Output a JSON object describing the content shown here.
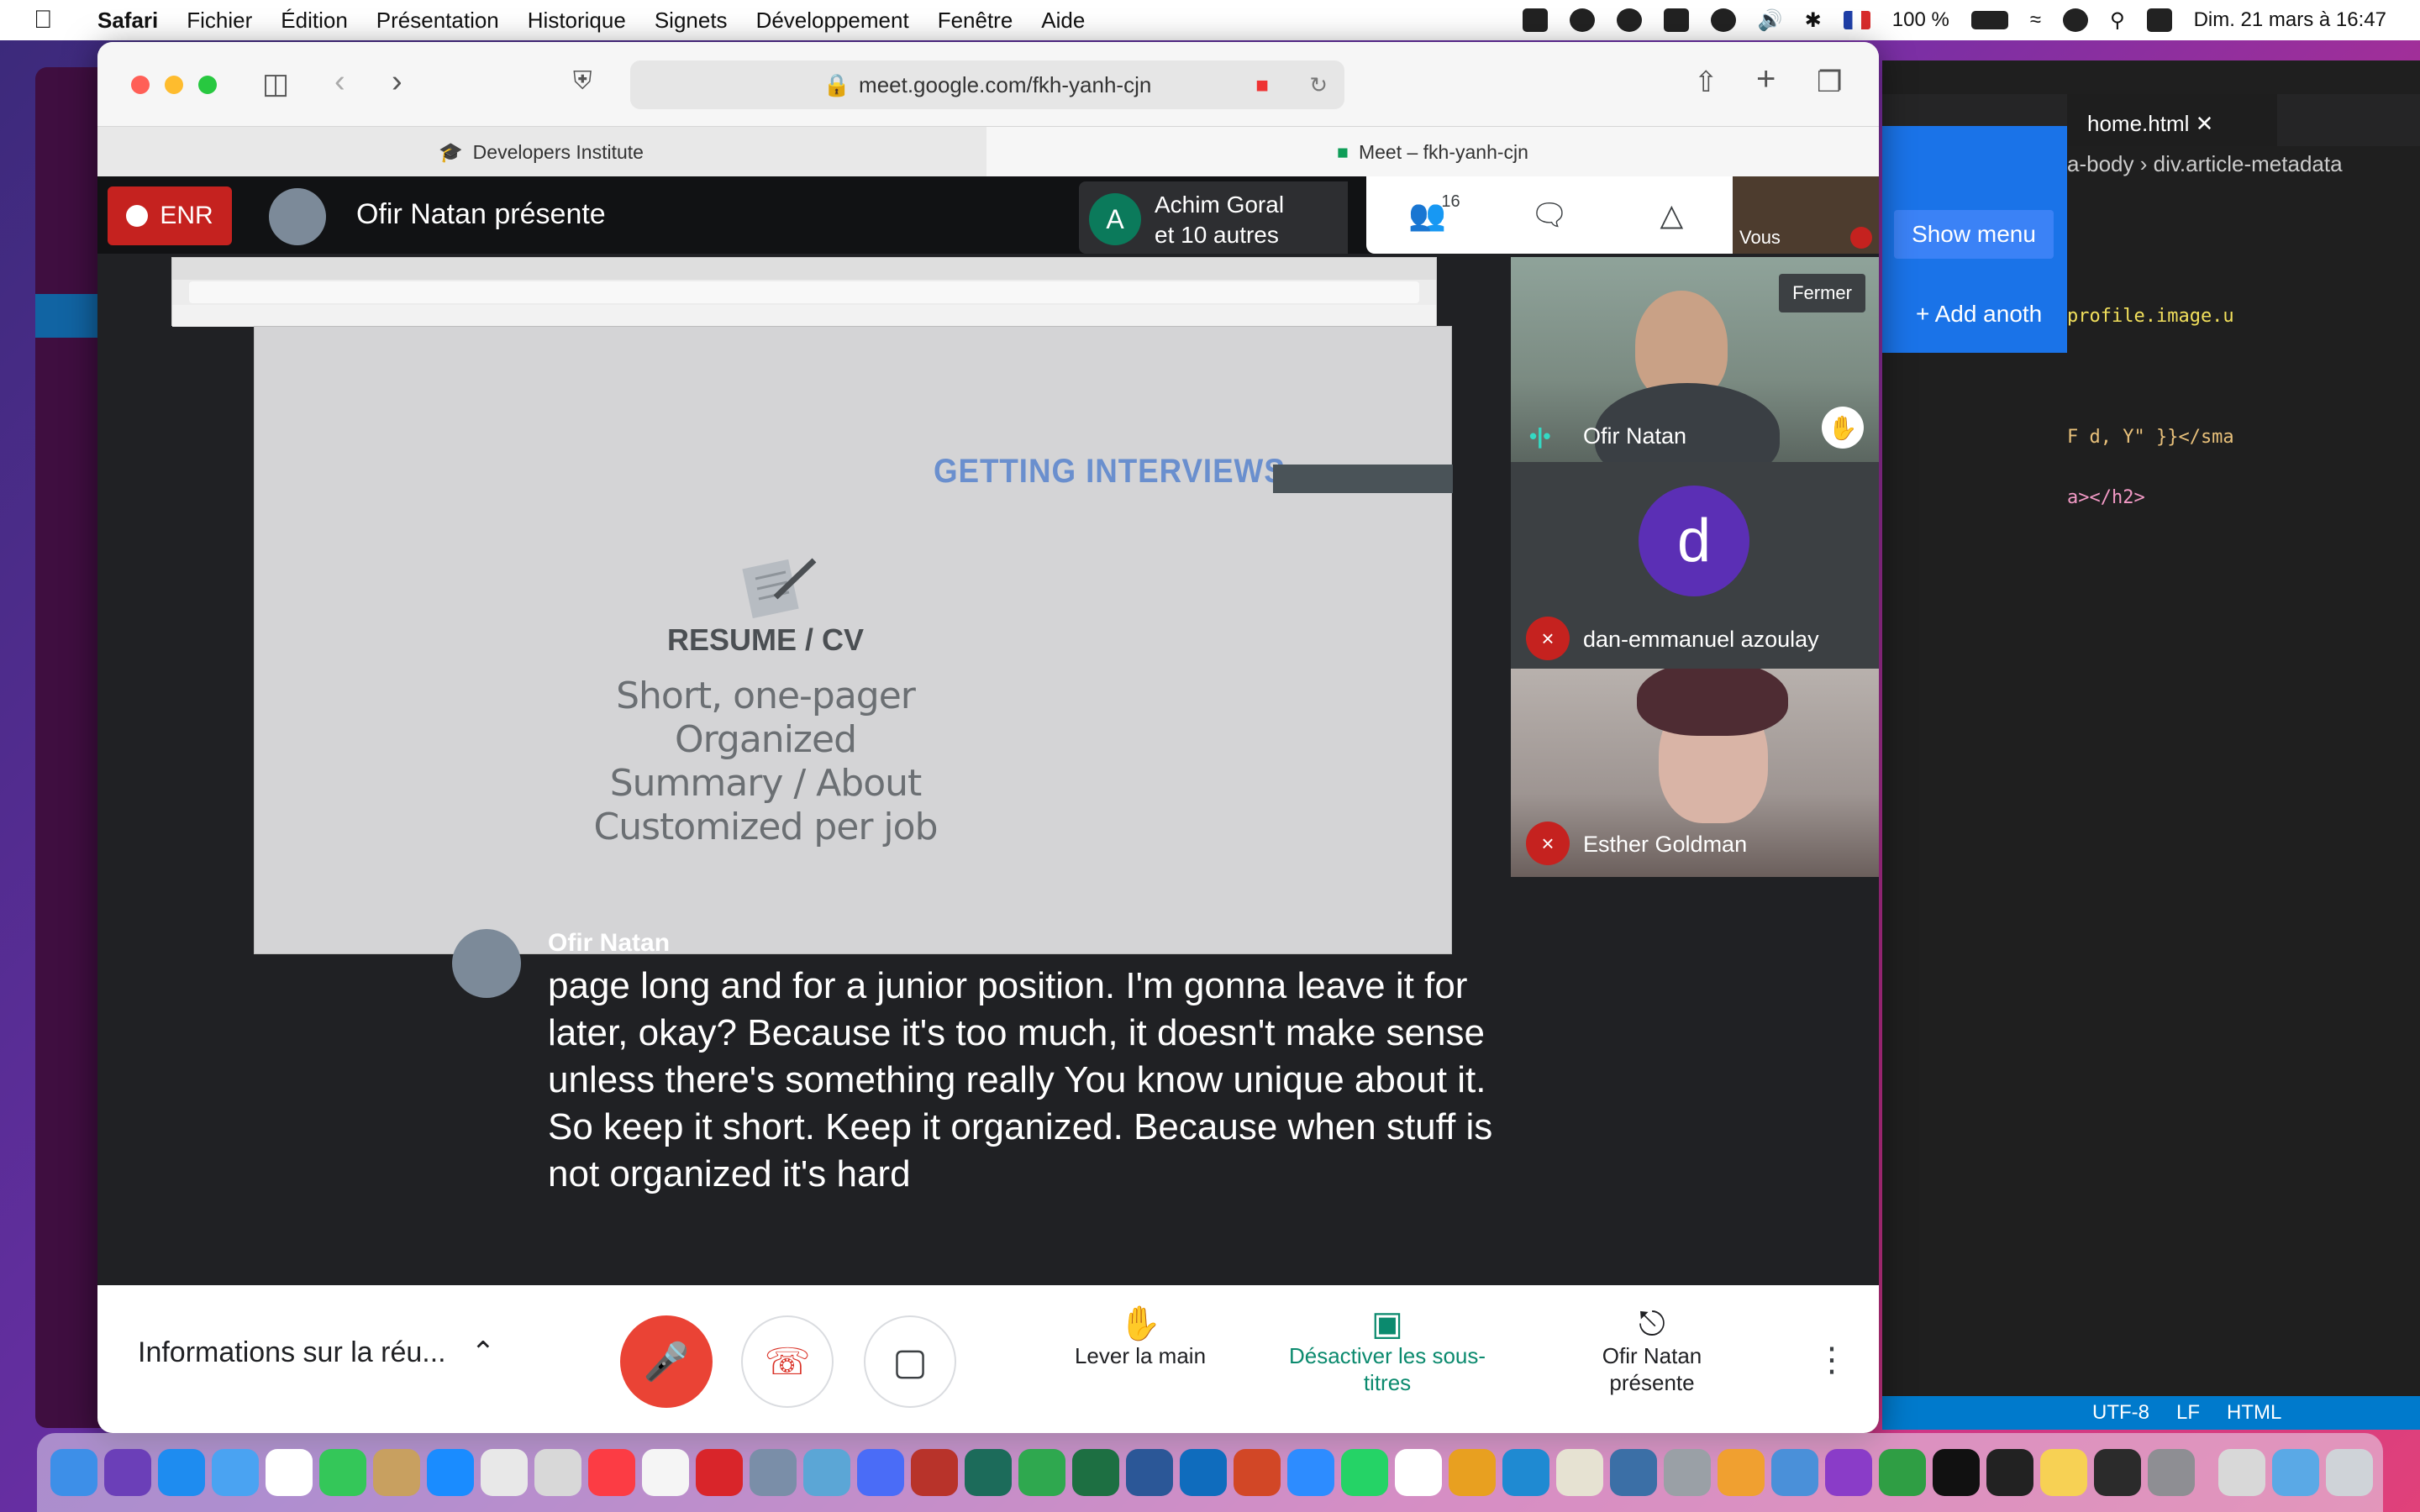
{
  "menubar": {
    "app": "Safari",
    "items": [
      "Fichier",
      "Édition",
      "Présentation",
      "Historique",
      "Signets",
      "Développement",
      "Fenêtre",
      "Aide"
    ],
    "battery": "100 %",
    "datetime": "Dim. 21 mars à  16:47"
  },
  "safari": {
    "url": "meet.google.com/fkh-yanh-cjn",
    "tabs": [
      "Developers Institute",
      "Meet – fkh-yanh-cjn"
    ]
  },
  "meet": {
    "rec_label": "ENR",
    "presenter_label": "Ofir Natan présente",
    "speaker_chip_initial": "A",
    "speaker_chip_line1": "Achim Goral",
    "speaker_chip_line2": "et 10 autres",
    "participants_count": "16",
    "self_label": "Vous",
    "slide": {
      "title": "GETTING INTERVIEWS",
      "heading": "RESUME / CV",
      "lines": [
        "Short, one-pager",
        "Organized",
        "Summary / About",
        "Customized per job"
      ]
    },
    "tiles": [
      {
        "name": "Ofir Natan",
        "tooltip": "Fermer"
      },
      {
        "name": "dan-emmanuel azoulay",
        "initial": "d"
      },
      {
        "name": "Esther Goldman"
      }
    ],
    "caption": {
      "speaker": "Ofir Natan",
      "text": "page long and for a junior position. I'm gonna leave it for later, okay? Because it's too much, it doesn't make sense unless there's something really You know unique about it. So keep it short. Keep it organized. Because when stuff is not organized it's hard"
    },
    "bottom": {
      "info_label": "Informations sur la réu...",
      "raise_hand": "Lever la main",
      "captions_off": "Désactiver les sous-titres",
      "present": "Ofir Natan présente"
    }
  },
  "vscode": {
    "tab": "home.html",
    "breadcrumb_1": "a-body",
    "breadcrumb_2": "div.article-metadata",
    "code_1": "profile.image.u",
    "code_2": "F d, Y\" }}</sma",
    "code_3": "a></h2>",
    "status": [
      "UTF-8",
      "LF",
      "HTML"
    ],
    "show_menu": "Show menu",
    "add_another": "+ Add anoth"
  },
  "colors": {
    "meet_bg": "#202124",
    "record_red": "#c5221f",
    "caption_green": "#0b8a6e",
    "slide_title_blue": "#6a8fce"
  }
}
